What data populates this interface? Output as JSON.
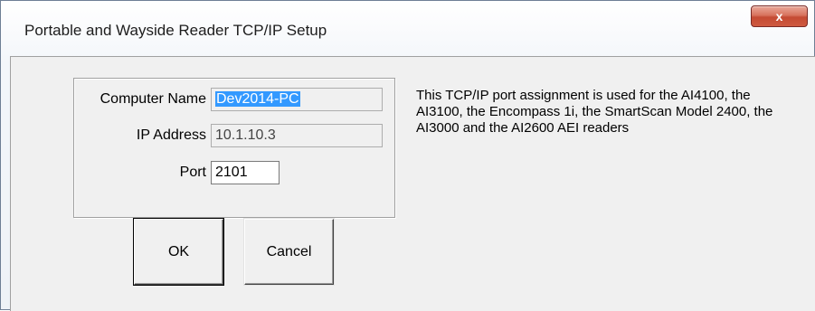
{
  "window": {
    "title": "Portable and Wayside Reader TCP/IP Setup",
    "close_icon": "close-icon",
    "close_glyph": "x"
  },
  "form": {
    "computer_name": {
      "label": "Computer Name",
      "value": "Dev2014-PC"
    },
    "ip_address": {
      "label": "IP Address",
      "value": "10.1.10.3"
    },
    "port": {
      "label": "Port",
      "value": "2101"
    }
  },
  "description": "This TCP/IP port assignment is used for the AI4100, the AI3100, the Encompass 1i, the SmartScan Model 2400, the AI3000 and the AI2600 AEI readers",
  "buttons": {
    "ok": "OK",
    "cancel": "Cancel"
  }
}
